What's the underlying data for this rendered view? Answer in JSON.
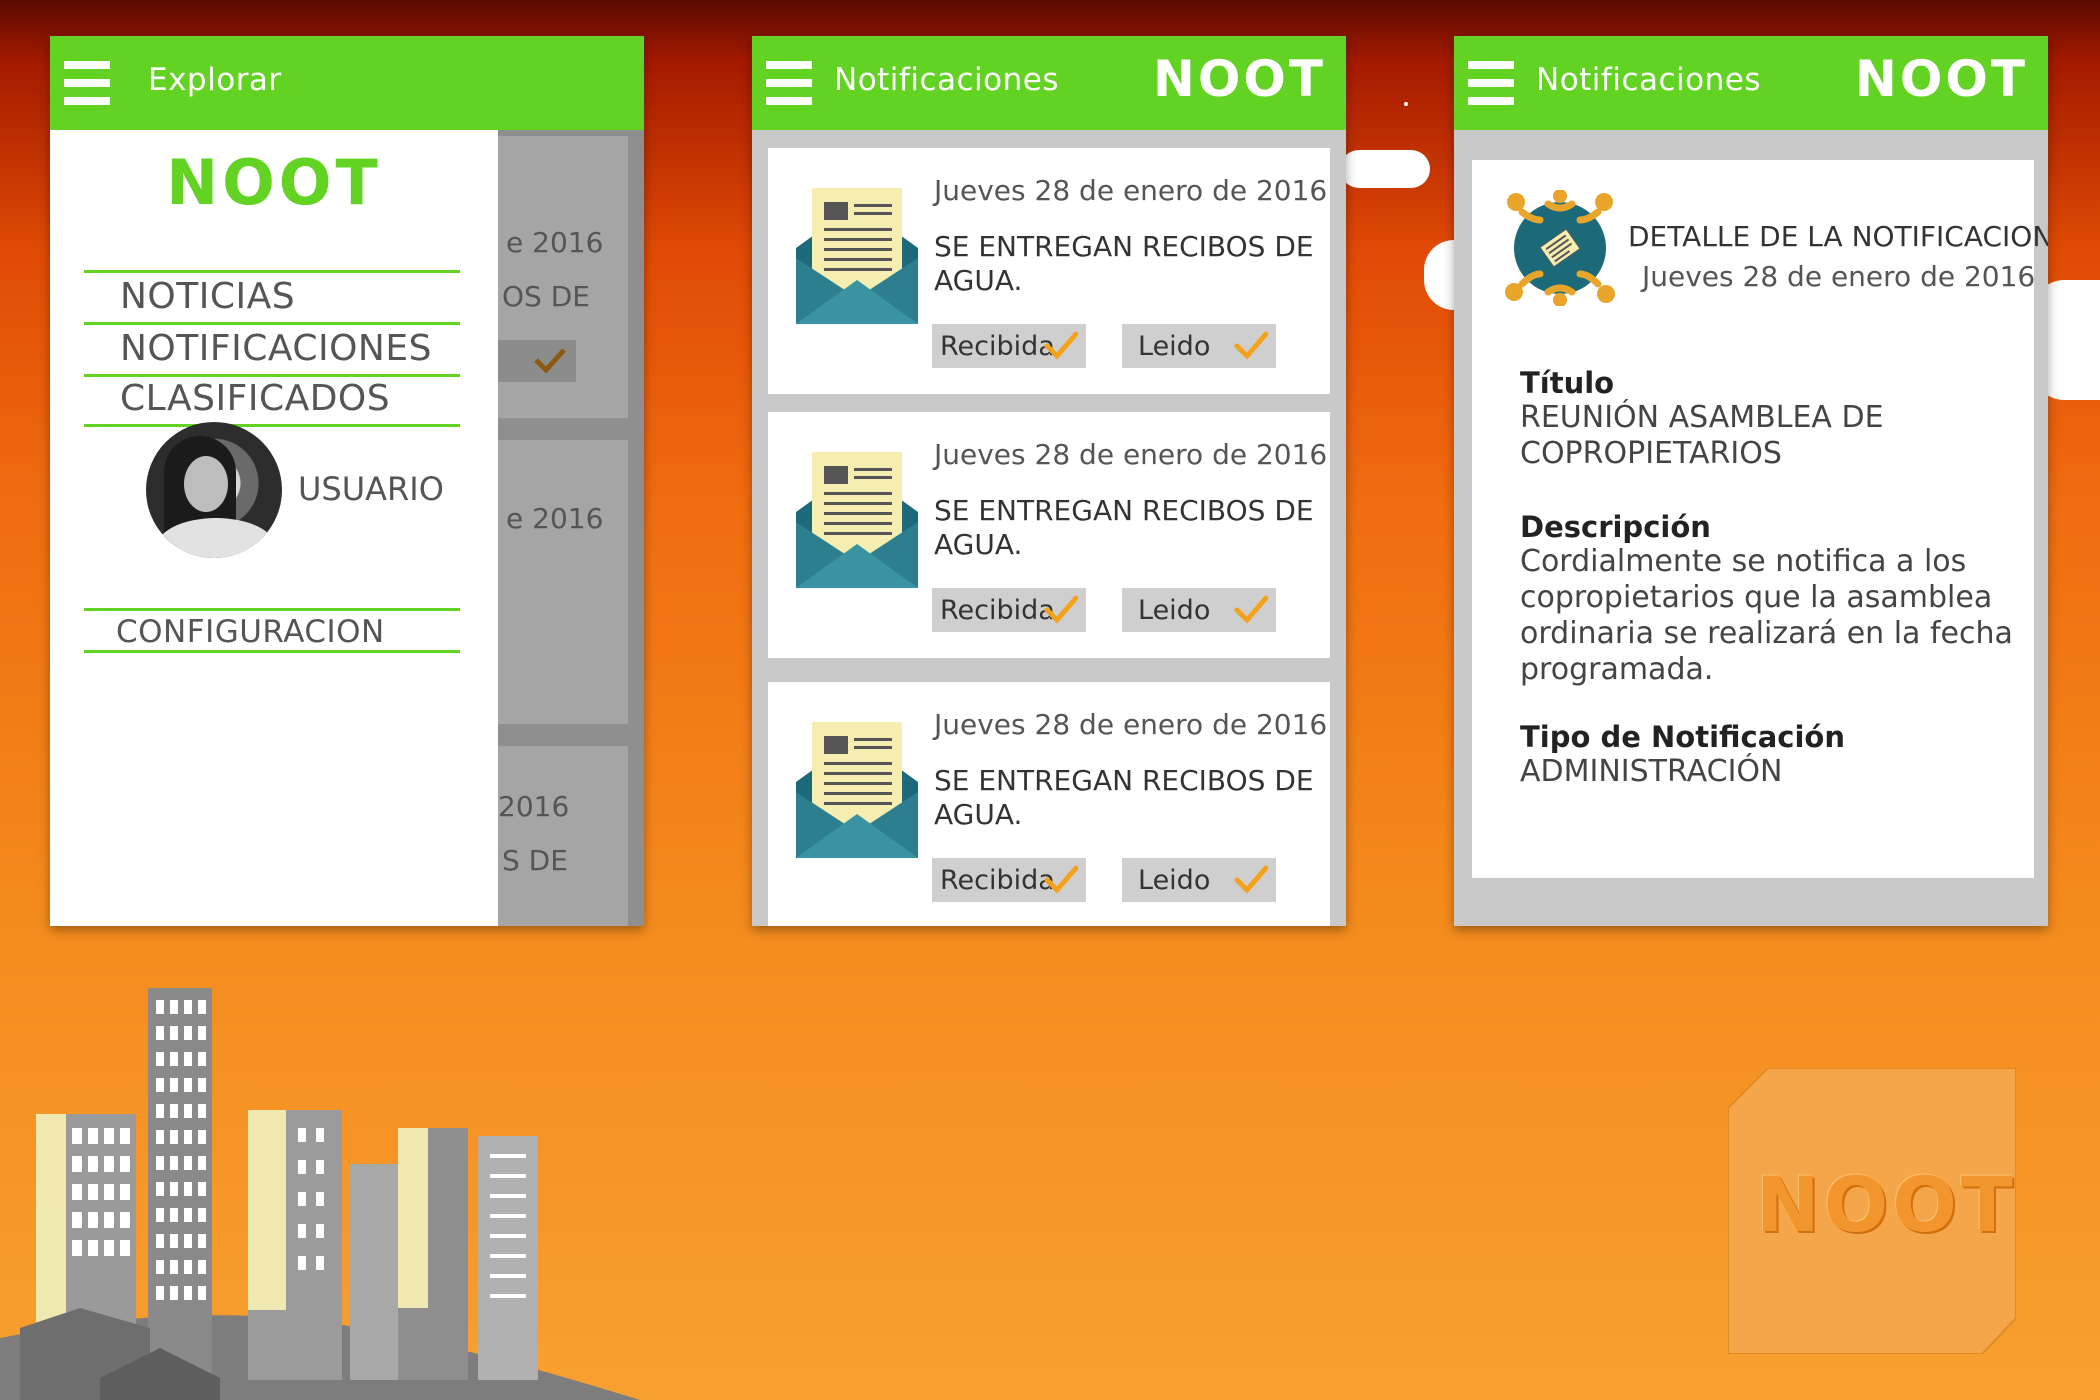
{
  "screens": {
    "explore": {
      "title": "Explorar",
      "logo": "NOOT",
      "menu": [
        "NOTICIAS",
        "NOTIFICACIONES",
        "CLASIFICADOS"
      ],
      "user_label": "USUARIO",
      "settings_label": "CONFIGURACION",
      "peek": {
        "date_1": "e 2016",
        "title_1": "OS DE",
        "date_2": "e 2016",
        "date_3": "2016",
        "title_3": "S DE"
      }
    },
    "notifications": {
      "title": "Notificaciones",
      "logo": "NOOT",
      "items": [
        {
          "date": "Jueves 28 de enero de 2016",
          "title": "SE ENTREGAN RECIBOS DE AGUA.",
          "received_label": "Recibida",
          "read_label": "Leido"
        },
        {
          "date": "Jueves 28 de enero de 2016",
          "title": "SE ENTREGAN RECIBOS DE AGUA.",
          "received_label": "Recibida",
          "read_label": "Leido"
        },
        {
          "date": "Jueves 28 de enero de 2016",
          "title": "SE ENTREGAN RECIBOS DE AGUA.",
          "received_label": "Recibida",
          "read_label": "Leido"
        }
      ]
    },
    "detail": {
      "title": "Notificaciones",
      "logo": "NOOT",
      "heading": "DETALLE DE LA NOTIFICACION",
      "date": "Jueves 28 de enero de 2016",
      "fields": {
        "title_label": "Título",
        "title_value": "REUNIÓN ASAMBLEA DE COPROPIETARIOS",
        "description_label": "Descripción",
        "description_value": "Cordialmente se notifica a los copropietarios que la asamblea ordinaria se realizará en la fecha programada.",
        "type_label": "Tipo de Notificación",
        "type_value": "ADMINISTRACIÓN"
      }
    }
  },
  "brand_tile": "NOOT",
  "colors": {
    "appbar": "#62d223",
    "check": "#f4a21a",
    "pill": "#cfcfcf",
    "envelope_body": "#2d7f8f",
    "letter": "#f5eeb0"
  }
}
